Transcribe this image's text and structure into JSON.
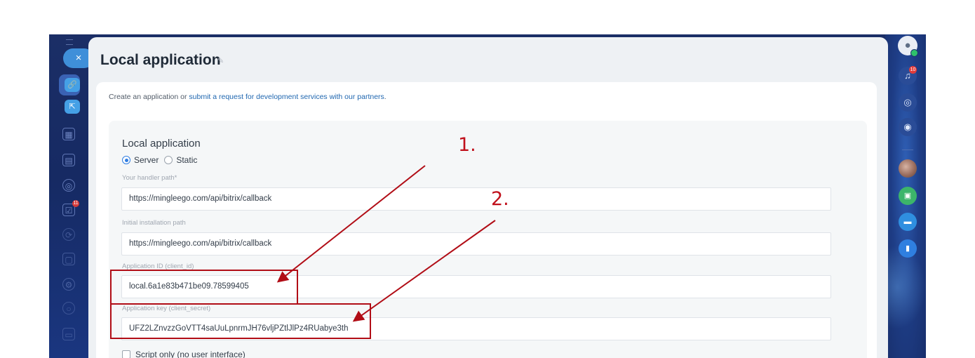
{
  "left_rail": {
    "close_glyph": "×",
    "badge_count": "11",
    "items": [
      {
        "icon": "link-icon",
        "glyph": "🔗"
      },
      {
        "icon": "external-link-icon",
        "glyph": "⇱"
      },
      {
        "icon": "calendar-icon",
        "glyph": "▦"
      },
      {
        "icon": "drive-icon",
        "glyph": "▤"
      },
      {
        "icon": "target-icon",
        "glyph": "◎"
      },
      {
        "icon": "tasks-icon",
        "glyph": "☑"
      },
      {
        "icon": "sync-icon",
        "glyph": "⟳"
      },
      {
        "icon": "chat-icon",
        "glyph": "▢"
      },
      {
        "icon": "settings-icon",
        "glyph": "⚙"
      },
      {
        "icon": "circle-icon",
        "glyph": "○"
      },
      {
        "icon": "document-icon",
        "glyph": "▭"
      }
    ]
  },
  "panel": {
    "title": "Local application",
    "edit_glyph": "✎",
    "intro_text": "Create an application or ",
    "intro_link": "submit a request for development services with our partners",
    "intro_end": ".",
    "form": {
      "section_title": "Local application",
      "radio_server": "Server",
      "radio_static": "Static",
      "selected_type": "Server",
      "handler_label": "Your handler path*",
      "handler_value": "https://mingleego.com/api/bitrix/callback",
      "install_label": "Initial installation path",
      "install_value": "https://mingleego.com/api/bitrix/callback",
      "client_id_label": "Application ID (client_id)",
      "client_id_value": "local.6a1e83b471be09.78599405",
      "client_secret_label": "Application key (client_secret)",
      "client_secret_value": "UFZ2LZnvzzGoVTT4saUuLpnrmJH76vljPZtlJlPz4RUabye3th",
      "script_only_label": "Script only (no user interface)",
      "script_only_checked": false
    }
  },
  "right_rail": {
    "notifications_badge": "10",
    "items": [
      "user-avatar-icon",
      "bell-icon",
      "spiral-icon",
      "message-icon",
      "profile-photo",
      "green-chat-icon",
      "blue-chat-icon",
      "bookmark-icon"
    ]
  },
  "annotations": {
    "label_1": "1.",
    "label_2": "2.",
    "color": "#b10d16"
  }
}
